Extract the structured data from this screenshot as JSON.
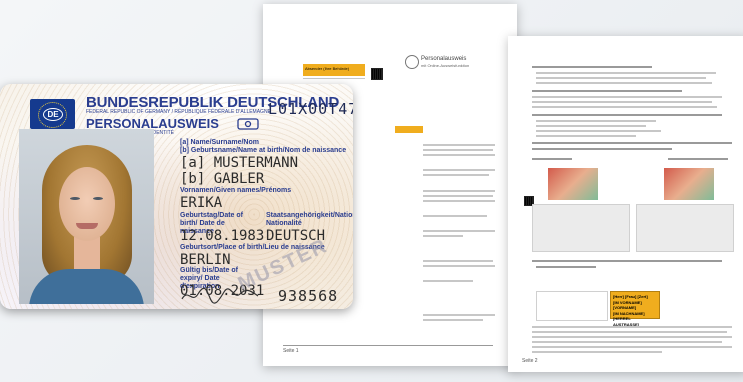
{
  "doc1": {
    "sender_label": "Absender (Ihre Behörde)",
    "logo_title": "Personalausweis",
    "logo_subtitle": "mit Online-Ausweisfunktion",
    "footer": "Seite 1"
  },
  "doc2": {
    "footer": "Seite 2",
    "selection_lines": [
      "[Herr] [Frau] [Zert]",
      "[IM VORNAME] [VORNAME]",
      "[IM NACHNAME]",
      "[HERREL AUSTRASSE]"
    ]
  },
  "card": {
    "country_code": "DE",
    "country_title": "BUNDESREPUBLIK DEUTSCHLAND",
    "country_subtitle": "FEDERAL REPUBLIC OF GERMANY / RÉPUBLIQUE FÉDÉRALE D'ALLEMAGNE",
    "doc_type": "PERSONALAUSWEIS",
    "doc_type_subtitle": "IDENTITY CARD / CARTE D'IDENTITÉ",
    "card_number": "L01X00T47",
    "surname_label": "[a] Name/Surname/Nom",
    "birthname_label": "[b] Geburtsname/Name at birth/Nom de naissance",
    "surname": "[a] MUSTERMANN",
    "birthname": "[b] GABLER",
    "given_names_label": "Vornamen/Given names/Prénoms",
    "given_names": "ERIKA",
    "dob_label": "Geburtstag/Date of birth/ Date de naissance",
    "dob": "12.08.1983",
    "nationality_label": "Staatsangehörigkeit/Nationality/ Nationalité",
    "nationality": "DEUTSCH",
    "birthplace_label": "Geburtsort/Place of birth/Lieu de naissance",
    "birthplace": "BERLIN",
    "expiry_label": "Gültig bis/Date of expiry/ Date d'expiration",
    "expiry": "01.08.2031",
    "stamp_text": "MUSTER",
    "can_number": "938568"
  },
  "colors": {
    "card_blue": "#2a3d8f",
    "eu_blue": "#153a8e",
    "highlight_orange": "#f0ad1e"
  }
}
